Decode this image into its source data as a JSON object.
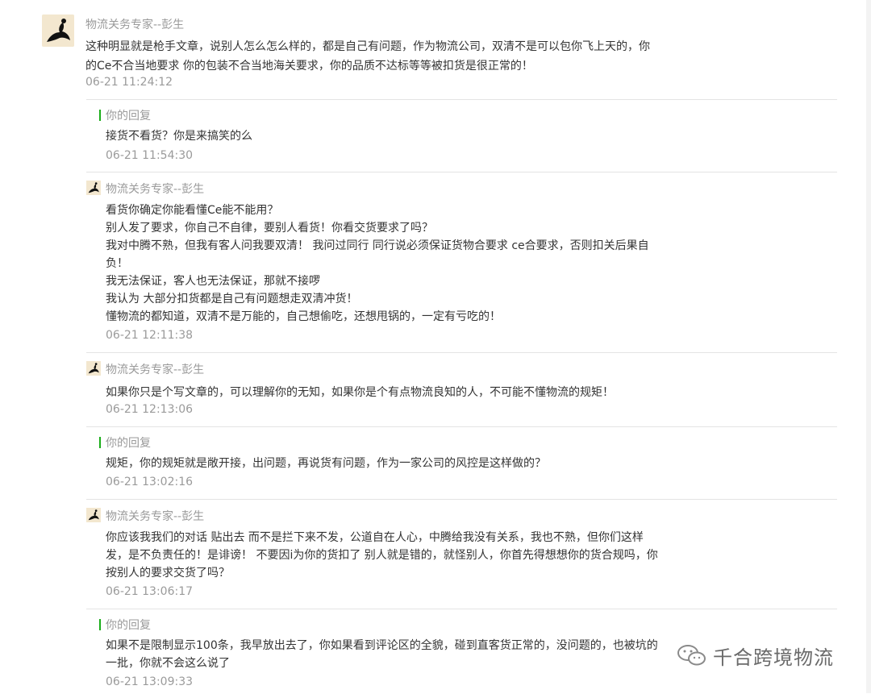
{
  "top": {
    "author": "物流关务专家--彭生",
    "text": "这种明显就是枪手文章，说别人怎么怎么样的，都是自己有问题，作为物流公司，双清不是可以包你飞上天的，你的Ce不合当地要求 你的包装不合当地海关要求，你的品质不达标等等被扣货是很正常的！",
    "time": "06-21 11:24:12"
  },
  "replies": [
    {
      "label": "你的回复",
      "text": "接货不看货？你是来搞笑的么",
      "time": "06-21 11:54:30"
    },
    {
      "author": "物流关务专家--彭生",
      "text": "看货你确定你能看懂Ce能不能用？\n别人发了要求，你自己不自律，要别人看货！你看交货要求了吗？\n我对中腾不熟，但我有客人问我要双清！ 我问过同行 同行说必须保证货物合要求 ce合要求，否则扣关后果自负！\n我无法保证，客人也无法保证，那就不接啰\n我认为 大部分扣货都是自己有问题想走双清冲货！\n懂物流的都知道，双清不是万能的，自己想偷吃，还想甩锅的，一定有亏吃的！",
      "time": "06-21 12:11:38"
    },
    {
      "author": "物流关务专家--彭生",
      "text": "如果你只是个写文章的，可以理解你的无知，如果你是个有点物流良知的人，不可能不懂物流的规矩！",
      "time": "06-21 12:13:06"
    },
    {
      "label": "你的回复",
      "text": "规矩，你的规矩就是敞开接，出问题，再说货有问题，作为一家公司的风控是这样做的？",
      "time": "06-21 13:02:16"
    },
    {
      "author": "物流关务专家--彭生",
      "text": "你应该我我们的对话 贴出去 而不是拦下来不发，公道自在人心，中腾给我没有关系，我也不熟，但你们这样发，是不负责任的！是诽谤！ 不要因i为你的货扣了 别人就是错的，就怪别人，你首先得想想你的货合规吗，你按别人的要求交货了吗？",
      "time": "06-21 13:06:17"
    },
    {
      "label": "你的回复",
      "text": "如果不是限制显示100条，我早放出去了，你如果看到评论区的全貌，碰到直客货正常的，没问题的，也被坑的一批，你就不会这么说了",
      "time": "06-21 13:09:33"
    }
  ],
  "watermark": {
    "text": "千合跨境物流",
    "icon": "wechat-icon"
  },
  "colors": {
    "accent": "#1aad19",
    "meta": "#9a9a9a",
    "text": "#333333",
    "divider": "#e4e4e4"
  }
}
